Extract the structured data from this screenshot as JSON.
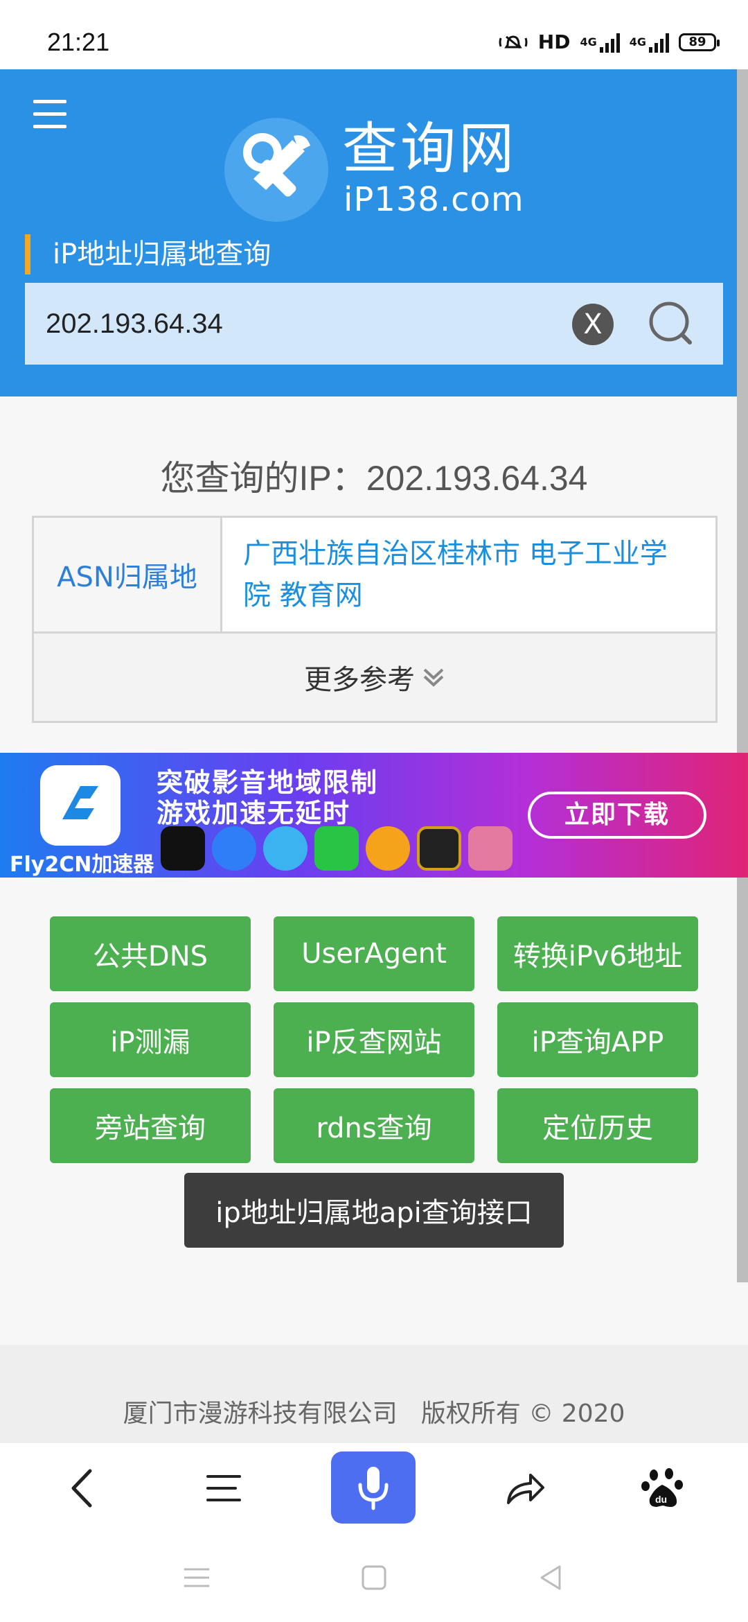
{
  "status_bar": {
    "time": "21:21",
    "hd_label": "HD",
    "net_label_1": "4G",
    "net_label_2": "4G",
    "battery": "89",
    "icons": [
      "silent-icon",
      "signal-icon",
      "signal-icon",
      "battery-icon"
    ]
  },
  "header": {
    "logo_title": "查询网",
    "logo_subtitle": "iP138.com",
    "section_title": "iP地址归属地查询",
    "search_value": "202.193.64.34",
    "clear_label": "X",
    "colors": {
      "background": "#2b91e5",
      "accent_bar": "#f5a623",
      "search_bg": "#d3e7fb"
    }
  },
  "result": {
    "heading": "您查询的IP：202.193.64.34",
    "rows": [
      {
        "label": "ASN归属地",
        "value": "广西壮族自治区桂林市 电子工业学院 教育网"
      }
    ],
    "more_label": "更多参考"
  },
  "banner": {
    "app_name": "Fly2CN加速器",
    "line1": "突破影音地域限制",
    "line2": "游戏加速无延时",
    "cta": "立即下载"
  },
  "tools": {
    "buttons": [
      "公共DNS",
      "UserAgent",
      "转换iPv6地址",
      "iP测漏",
      "iP反查网站",
      "iP查询APP",
      "旁站查询",
      "rdns查询",
      "定位历史"
    ],
    "api_button": "ip地址归属地api查询接口",
    "colors": {
      "tool_bg": "#4caf50",
      "api_bg": "#3d3d3d"
    }
  },
  "footer": {
    "copyright": "厦门市漫游科技有限公司   版权所有 © 2020"
  },
  "browser_toolbar": {
    "icons": [
      "back-icon",
      "menu-icon",
      "microphone-icon",
      "share-icon",
      "baidu-icon"
    ],
    "mic_color": "#4e6ef2"
  },
  "system_nav": {
    "icons": [
      "recents-icon",
      "home-icon",
      "back-triangle-icon"
    ]
  }
}
